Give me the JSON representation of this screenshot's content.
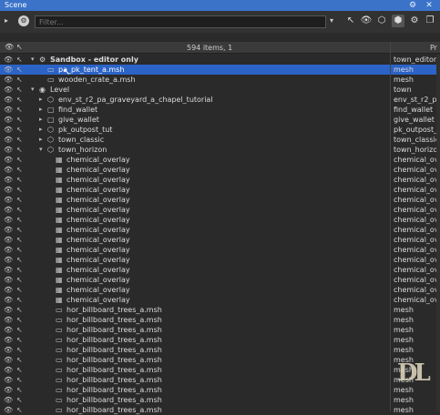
{
  "window": {
    "title": "Scene"
  },
  "toolbar": {
    "filter_placeholder": "Filter..."
  },
  "header": {
    "count": "594 items, 1",
    "col2": "Pr"
  },
  "rows": [
    {
      "name": "Sandbox - editor only",
      "type": "town_editor",
      "icon": "sandbox-icon",
      "glyph": "⚙",
      "expander": "▾",
      "indent": 0,
      "bold": true
    },
    {
      "name": "pa_pk_tent_a.msh",
      "type": "mesh",
      "icon": "mesh-file-icon",
      "glyph": "▭",
      "expander": "",
      "indent": 1,
      "selected": true
    },
    {
      "name": "wooden_crate_a.msh",
      "type": "mesh",
      "icon": "mesh-file-icon",
      "glyph": "▭",
      "expander": "",
      "indent": 1
    },
    {
      "name": "Level",
      "type": "town",
      "icon": "level-icon",
      "glyph": "◉",
      "expander": "▾",
      "indent": 0
    },
    {
      "name": "env_st_r2_pa_graveyard_a_chapel_tutorial",
      "type": "env_st_r2_pa",
      "icon": "box-icon",
      "glyph": "⬡",
      "expander": "▸",
      "indent": 1
    },
    {
      "name": "find_wallet",
      "type": "find_wallet",
      "icon": "script-icon",
      "glyph": "▢",
      "expander": "▸",
      "indent": 1
    },
    {
      "name": "give_wallet",
      "type": "give_wallet",
      "icon": "script-icon",
      "glyph": "▢",
      "expander": "▸",
      "indent": 1
    },
    {
      "name": "pk_outpost_tut",
      "type": "pk_outpost_t",
      "icon": "box-icon",
      "glyph": "⬡",
      "expander": "▸",
      "indent": 1
    },
    {
      "name": "town_classic",
      "type": "town_classic",
      "icon": "box-icon",
      "glyph": "⬡",
      "expander": "▸",
      "indent": 1
    },
    {
      "name": "town_horizon",
      "type": "town_horizon",
      "icon": "box-icon",
      "glyph": "⬡",
      "expander": "▾",
      "indent": 1
    },
    {
      "name": "chemical_overlay",
      "type": "chemical_ov",
      "icon": "overlay-icon",
      "glyph": "▦",
      "expander": "",
      "indent": 2
    },
    {
      "name": "chemical_overlay",
      "type": "chemical_ov",
      "icon": "overlay-icon",
      "glyph": "▦",
      "expander": "",
      "indent": 2
    },
    {
      "name": "chemical_overlay",
      "type": "chemical_ov",
      "icon": "overlay-icon",
      "glyph": "▦",
      "expander": "",
      "indent": 2
    },
    {
      "name": "chemical_overlay",
      "type": "chemical_ov",
      "icon": "overlay-icon",
      "glyph": "▦",
      "expander": "",
      "indent": 2
    },
    {
      "name": "chemical_overlay",
      "type": "chemical_ov",
      "icon": "overlay-icon",
      "glyph": "▦",
      "expander": "",
      "indent": 2
    },
    {
      "name": "chemical_overlay",
      "type": "chemical_ov",
      "icon": "overlay-icon",
      "glyph": "▦",
      "expander": "",
      "indent": 2
    },
    {
      "name": "chemical_overlay",
      "type": "chemical_ov",
      "icon": "overlay-icon",
      "glyph": "▦",
      "expander": "",
      "indent": 2
    },
    {
      "name": "chemical_overlay",
      "type": "chemical_ov",
      "icon": "overlay-icon",
      "glyph": "▦",
      "expander": "",
      "indent": 2
    },
    {
      "name": "chemical_overlay",
      "type": "chemical_ov",
      "icon": "overlay-icon",
      "glyph": "▦",
      "expander": "",
      "indent": 2
    },
    {
      "name": "chemical_overlay",
      "type": "chemical_ov",
      "icon": "overlay-icon",
      "glyph": "▦",
      "expander": "",
      "indent": 2
    },
    {
      "name": "chemical_overlay",
      "type": "chemical_ov",
      "icon": "overlay-icon",
      "glyph": "▦",
      "expander": "",
      "indent": 2
    },
    {
      "name": "chemical_overlay",
      "type": "chemical_ov",
      "icon": "overlay-icon",
      "glyph": "▦",
      "expander": "",
      "indent": 2
    },
    {
      "name": "chemical_overlay",
      "type": "chemical_ov",
      "icon": "overlay-icon",
      "glyph": "▦",
      "expander": "",
      "indent": 2
    },
    {
      "name": "chemical_overlay",
      "type": "chemical_ov",
      "icon": "overlay-icon",
      "glyph": "▦",
      "expander": "",
      "indent": 2
    },
    {
      "name": "chemical_overlay",
      "type": "chemical_ov",
      "icon": "overlay-icon",
      "glyph": "▦",
      "expander": "",
      "indent": 2
    },
    {
      "name": "hor_billboard_trees_a.msh",
      "type": "mesh",
      "icon": "mesh-file-icon",
      "glyph": "▭",
      "expander": "",
      "indent": 2
    },
    {
      "name": "hor_billboard_trees_a.msh",
      "type": "mesh",
      "icon": "mesh-file-icon",
      "glyph": "▭",
      "expander": "",
      "indent": 2
    },
    {
      "name": "hor_billboard_trees_a.msh",
      "type": "mesh",
      "icon": "mesh-file-icon",
      "glyph": "▭",
      "expander": "",
      "indent": 2
    },
    {
      "name": "hor_billboard_trees_a.msh",
      "type": "mesh",
      "icon": "mesh-file-icon",
      "glyph": "▭",
      "expander": "",
      "indent": 2
    },
    {
      "name": "hor_billboard_trees_a.msh",
      "type": "mesh",
      "icon": "mesh-file-icon",
      "glyph": "▭",
      "expander": "",
      "indent": 2
    },
    {
      "name": "hor_billboard_trees_a.msh",
      "type": "mesh",
      "icon": "mesh-file-icon",
      "glyph": "▭",
      "expander": "",
      "indent": 2
    },
    {
      "name": "hor_billboard_trees_a.msh",
      "type": "mesh",
      "icon": "mesh-file-icon",
      "glyph": "▭",
      "expander": "",
      "indent": 2
    },
    {
      "name": "hor_billboard_trees_a.msh",
      "type": "mesh",
      "icon": "mesh-file-icon",
      "glyph": "▭",
      "expander": "",
      "indent": 2
    },
    {
      "name": "hor_billboard_trees_a.msh",
      "type": "mesh",
      "icon": "mesh-file-icon",
      "glyph": "▭",
      "expander": "",
      "indent": 2
    },
    {
      "name": "hor_billboard_trees_a.msh",
      "type": "mesh",
      "icon": "mesh-file-icon",
      "glyph": "▭",
      "expander": "",
      "indent": 2
    },
    {
      "name": "hor_billboard_trees_a.msh",
      "type": "mesh",
      "icon": "mesh-file-icon",
      "glyph": "▭",
      "expander": "",
      "indent": 2
    }
  ],
  "colors": {
    "accent": "#3a73c8",
    "selection": "#2b63c6",
    "background": "#2a2a2a"
  },
  "watermark": "DL"
}
